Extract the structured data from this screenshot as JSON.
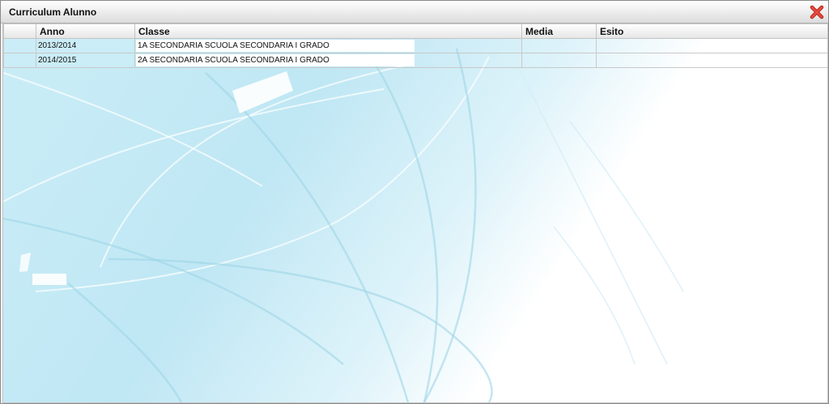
{
  "window": {
    "title": "Curriculum Alunno",
    "close_icon": "close-x-icon",
    "accent": "#d63a2f"
  },
  "table": {
    "columns": [
      "",
      "Anno",
      "Classe",
      "Media",
      "Esito"
    ],
    "rows": [
      {
        "anno": "2013/2014",
        "classe": "1A SECONDARIA SCUOLA SECONDARIA I GRADO",
        "media": "",
        "esito": ""
      },
      {
        "anno": "2014/2015",
        "classe": "2A SECONDARIA SCUOLA SECONDARIA I GRADO",
        "media": "",
        "esito": ""
      }
    ]
  },
  "background": {
    "primary": "#b9e6f3",
    "secondary": "#e5f5fb"
  }
}
